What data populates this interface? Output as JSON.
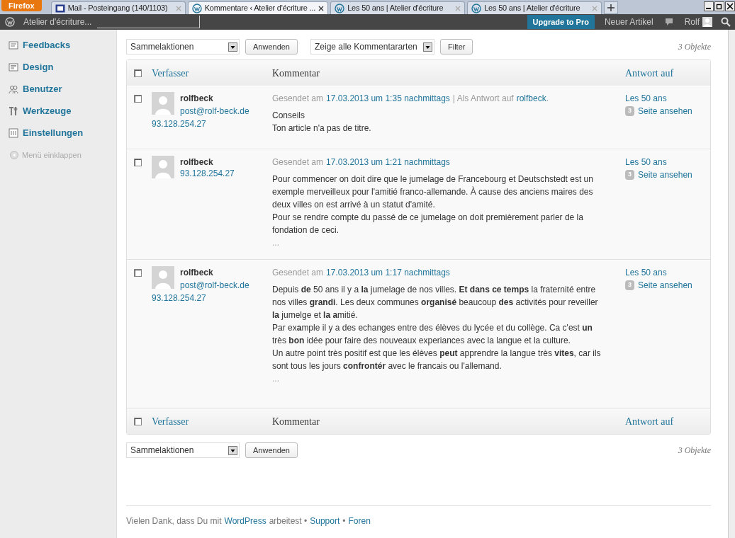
{
  "browser": {
    "menu_button": "Firefox",
    "tabs": [
      {
        "label": "Mail - Posteingang (140/1103)",
        "selected": false,
        "kind": "mail"
      },
      {
        "label": "Kommentare ‹ Atelier d'écriture ...",
        "selected": true,
        "kind": "wp"
      },
      {
        "label": "Les 50 ans | Atelier d'écriture",
        "selected": false,
        "kind": "wp"
      },
      {
        "label": "Les 50 ans | Atelier d'écriture",
        "selected": false,
        "kind": "wp"
      }
    ]
  },
  "admin_bar": {
    "site": "Atelier d'écriture...",
    "upgrade": "Upgrade to Pro",
    "new_post": "Neuer Artikel",
    "user": "Rolf"
  },
  "sidebar": {
    "items": [
      {
        "label": "Feedbacks",
        "kind": "feedback"
      },
      {
        "label": "Design",
        "kind": "design"
      },
      {
        "label": "Benutzer",
        "kind": "users"
      },
      {
        "label": "Werkzeuge",
        "kind": "tools"
      },
      {
        "label": "Einstellungen",
        "kind": "settings"
      }
    ],
    "collapse": "Menü einklappen"
  },
  "toolbar": {
    "bulk_select": "Sammelaktionen",
    "apply": "Anwenden",
    "type_select": "Zeige alle Kommentararten",
    "filter": "Filter",
    "count": "3 Objekte"
  },
  "table": {
    "columns": [
      "Verfasser",
      "Kommentar",
      "Antwort auf"
    ],
    "header_checked": false,
    "rows": [
      {
        "checked": false,
        "author": "rolfbeck",
        "email": "post@rolf-beck.de",
        "ip": "93.128.254.27",
        "submitted_prefix": "Gesendet am",
        "date": "17.03.2013 um 1:35 nachmittags",
        "reply_prefix": "| Als Antwort auf",
        "reply_to": "rolfbeck",
        "reply_suffix": ".",
        "paragraphs": [
          "Conseils",
          "Ton article n'a pas de titre."
        ],
        "more": null,
        "post": "Les 50 ans",
        "comment_count": "3",
        "view": "Seite ansehen"
      },
      {
        "checked": false,
        "author": "rolfbeck",
        "email": null,
        "ip": "93.128.254.27",
        "submitted_prefix": "Gesendet am",
        "date": "17.03.2013 um 1:21 nachmittags",
        "paragraphs": [
          "Pour commencer on doit dire que le jumelage de Francebourg et Deutschstedt est un exemple merveilleux pour l'amitié franco-allemande. À cause des anciens maires des deux villes on est arrivé à un statut d'amité.",
          "Pour se rendre compte du passé de ce jumelage on doit premièrement parler de la fondation de ceci."
        ],
        "more": "...",
        "post": "Les 50 ans",
        "comment_count": "3",
        "view": "Seite ansehen"
      },
      {
        "checked": false,
        "author": "rolfbeck",
        "email": "post@rolf-beck.de",
        "ip": "93.128.254.27",
        "submitted_prefix": "Gesendet am",
        "date": "17.03.2013 um 1:17 nachmittags",
        "paragraphs": [
          "Depuis **de** 50 ans il y a **la** jumelage de nos villes. **Et dans ce temps** la fraternité entre nos villes **grandi**. Les deux communes **organisé** beaucoup **des** activités pour reveiller **la** jumelge et **la a**mitié.",
          "Par ex**a**mple il y a des echanges entre des élèves du lycée et du collège. Ca c'est **un** très **bon** idée pour faire des nouveaux experiances avec la langue et la culture.",
          "Un autre point très positif est que les élèves **peut** apprendre la langue très **vites**, car ils sont tous les jours **confrontér** avec le francais ou l'allemand."
        ],
        "more": "...",
        "post": "Les 50 ans",
        "comment_count": "3",
        "view": "Seite ansehen"
      }
    ],
    "footer_columns": [
      "Verfasser",
      "Kommentar",
      "Antwort auf"
    ],
    "footer_checked": false
  },
  "bottom_toolbar": {
    "bulk_select": "Sammelaktionen",
    "apply": "Anwenden",
    "count": "3 Objekte"
  },
  "footer": [
    {
      "kind": "text",
      "text": "Vielen Dank, dass Du mit"
    },
    {
      "kind": "link",
      "text": "WordPress"
    },
    {
      "kind": "text",
      "text": "arbeitest •"
    },
    {
      "kind": "link",
      "text": "Support"
    },
    {
      "kind": "text",
      "text": "•"
    },
    {
      "kind": "link",
      "text": "Foren"
    }
  ]
}
